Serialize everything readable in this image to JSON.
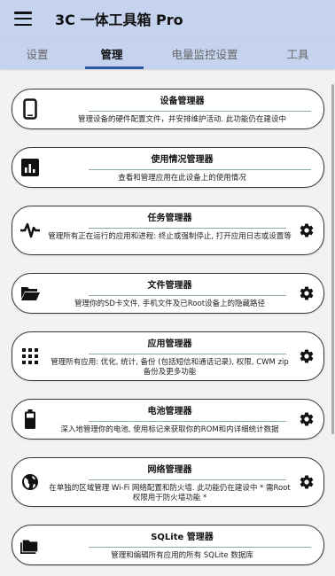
{
  "app": {
    "title": "3C 一体工具箱 Pro"
  },
  "tabs": [
    {
      "label": "设置",
      "active": false
    },
    {
      "label": "管理",
      "active": true
    },
    {
      "label": "电量监控设置",
      "active": false
    },
    {
      "label": "工具",
      "active": false
    }
  ],
  "accent_color": "#2d55a8",
  "appbar_color": "#c5d3ef",
  "cards": [
    {
      "title": "设备管理器",
      "desc": "管理设备的硬件配置文件，并安排维护活动. 此功能仍在建设中",
      "icon": "phone-icon",
      "gear": false
    },
    {
      "title": "使用情况管理器",
      "desc": "查看和管理应用在此设备上的使用情况",
      "icon": "bar-chart-icon",
      "gear": false
    },
    {
      "title": "任务管理器",
      "desc": "管理所有正在运行的应用和进程: 终止或强制停止, 打开应用日志或设置等",
      "icon": "pulse-icon",
      "gear": true
    },
    {
      "title": "文件管理器",
      "desc": "管理你的SD卡文件, 手机文件及已Root设备上的隐藏路径",
      "icon": "folder-open-icon",
      "gear": true
    },
    {
      "title": "应用管理器",
      "desc": "管理所有应用: 优化, 统计, 备份 (包括短信和通话记录), 权限, CWM zip备份及更多功能",
      "icon": "apps-grid-icon",
      "gear": true
    },
    {
      "title": "电池管理器",
      "desc": "深入地管理你的电池, 使用标记来获取你的ROM和内详细统计数据",
      "icon": "battery-icon",
      "gear": true
    },
    {
      "title": "网络管理器",
      "desc": "在单独的区域管理 Wi-Fi 网络配置和防火墙. 此功能仍在建设中 * 需Root权限用于防火墙功能 *",
      "icon": "globe-icon",
      "gear": true
    },
    {
      "title": "SQLite 管理器",
      "desc": "管理和编辑所有应用的所有 SQLite 数据库",
      "icon": "folder-icon",
      "gear": false
    }
  ]
}
